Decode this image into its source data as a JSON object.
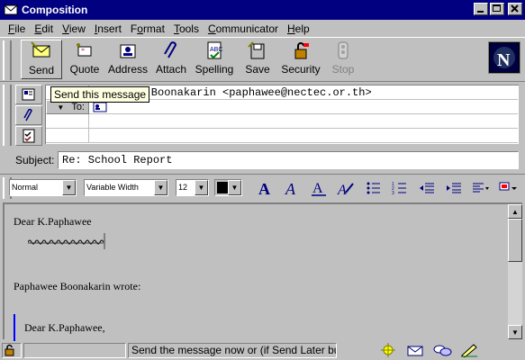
{
  "window": {
    "title": "Composition"
  },
  "menu": {
    "items": [
      {
        "u": "F",
        "rest": "ile"
      },
      {
        "u": "E",
        "rest": "dit"
      },
      {
        "u": "V",
        "rest": "iew"
      },
      {
        "u": "I",
        "rest": "nsert"
      },
      {
        "pre": "F",
        "u": "o",
        "rest": "rmat"
      },
      {
        "u": "T",
        "rest": "ools"
      },
      {
        "u": "C",
        "rest": "ommunicator"
      },
      {
        "u": "H",
        "rest": "elp"
      }
    ]
  },
  "toolbar": {
    "buttons": [
      {
        "label": "Send",
        "icon": "send-icon"
      },
      {
        "label": "Quote",
        "icon": "quote-icon"
      },
      {
        "label": "Address",
        "icon": "address-icon"
      },
      {
        "label": "Attach",
        "icon": "attach-icon"
      },
      {
        "label": "Spelling",
        "icon": "spelling-icon"
      },
      {
        "label": "Save",
        "icon": "save-icon"
      },
      {
        "label": "Security",
        "icon": "security-icon"
      },
      {
        "label": "Stop",
        "icon": "stop-icon"
      }
    ]
  },
  "tooltip": "Send this message",
  "address": {
    "from_value": "Paphawee Boonakarin <paphawee@nectec.or.th>",
    "to_label": "To:"
  },
  "subject": {
    "label": "Subject:",
    "value": "Re: School Report"
  },
  "format": {
    "paragraph_style": "Normal",
    "font": "Variable Width",
    "size": "12",
    "color": "#000000"
  },
  "body": {
    "greeting": "Dear K.Paphawee",
    "quote_header": "Paphawee Boonakarin wrote:",
    "quoted_greeting": "Dear K.Paphawee,"
  },
  "status": {
    "message": "Send the message now  or (if Send Later button is visible) queue the message"
  },
  "colors": {
    "titlebar": "#000080",
    "face": "#c0c0c0",
    "quote_bar": "#0000ff",
    "tooltip_bg": "#ffffe1"
  }
}
